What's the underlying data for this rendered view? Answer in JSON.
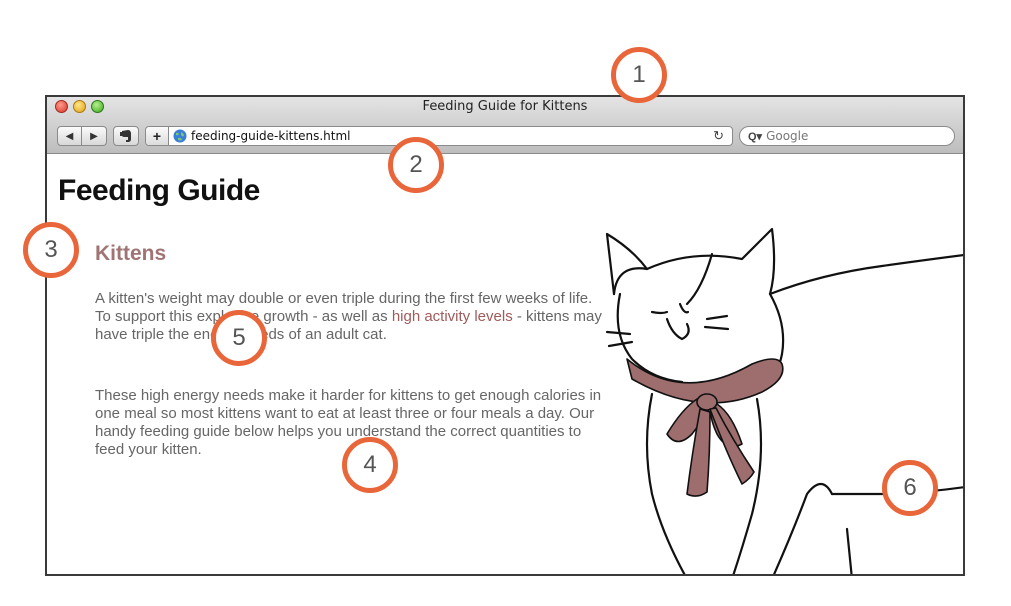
{
  "window": {
    "title": "Feeding Guide for Kittens"
  },
  "toolbar": {
    "back_glyph": "◀",
    "forward_glyph": "▶",
    "new_tab_glyph": "+",
    "url": "feeding-guide-kittens.html",
    "reload_glyph": "↻",
    "search_glyph": "Q▾",
    "search_placeholder": "Google"
  },
  "page": {
    "title": "Feeding Guide",
    "subtitle": "Kittens",
    "paragraph1": {
      "before": "A kitten's weight may double or even triple during the first few weeks of life. To support this explosive growth - as well as ",
      "highlight": "high activity levels",
      "after": " - kittens may have triple the energy needs of an adult cat."
    },
    "paragraph2": "These high energy needs make it harder for kittens to get enough calories in one meal so most kittens want to eat at least three or four meals a day. Our handy feeding guide below helps you understand the correct quantities to feed your kitten."
  },
  "callouts": [
    "1",
    "2",
    "3",
    "4",
    "5",
    "6"
  ],
  "colors": {
    "accent": "#e8663a",
    "subtitle": "#a07474",
    "highlight": "#a05a5a",
    "bow": "#9e6e6e"
  },
  "icons": {
    "close": "close-icon",
    "minimize": "minimize-icon",
    "zoom": "zoom-icon",
    "evernote": "evernote-icon",
    "globe": "globe-icon",
    "reload": "reload-icon",
    "search": "search-icon"
  }
}
